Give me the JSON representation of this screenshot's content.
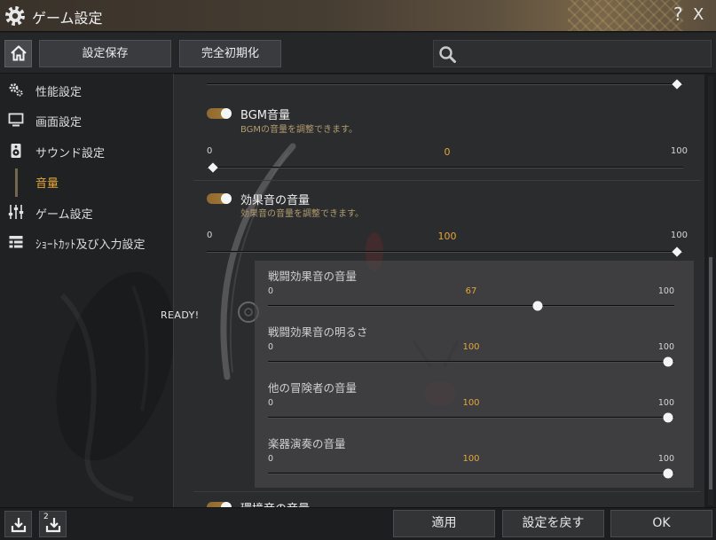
{
  "window": {
    "title": "ゲーム設定",
    "help_label": "?",
    "close_label": "X"
  },
  "toolbar": {
    "home_icon": "home-icon",
    "save_label": "設定保存",
    "reset_all_label": "完全初期化",
    "search": {
      "placeholder": "",
      "value": ""
    },
    "search_icon": "search-icon"
  },
  "sidebar": {
    "items": [
      {
        "label": "性能設定",
        "icon": "gears-icon"
      },
      {
        "label": "画面設定",
        "icon": "monitor-icon"
      },
      {
        "label": "サウンド設定",
        "icon": "speaker-icon"
      },
      {
        "label": "音量",
        "active": true
      },
      {
        "label": "ゲーム設定",
        "icon": "sliders-icon"
      },
      {
        "label": "ｼｮｰﾄｶｯﾄ及び入力設定",
        "icon": "list-icon"
      }
    ]
  },
  "main": {
    "top_slider": {
      "value": 100
    },
    "bgm": {
      "title": "BGM音量",
      "description": "BGMの音量を調整できます。",
      "enabled": true,
      "min": 0,
      "value": 0,
      "max": 100
    },
    "effects": {
      "title": "効果音の音量",
      "description": "効果音の音量を調整できます。",
      "enabled": true,
      "min": 0,
      "value": 100,
      "max": 100
    },
    "sub_sliders": [
      {
        "title": "戦闘効果音の音量",
        "min": 0,
        "value": 67,
        "max": 100
      },
      {
        "title": "戦闘効果音の明るさ",
        "min": 0,
        "value": 100,
        "max": 100
      },
      {
        "title": "他の冒険者の音量",
        "min": 0,
        "value": 100,
        "max": 100
      },
      {
        "title": "楽器演奏の音量",
        "min": 0,
        "value": 100,
        "max": 100
      }
    ],
    "ambient": {
      "title": "環境音の音量",
      "enabled": true
    }
  },
  "footer": {
    "preset_2_badge": "2",
    "apply_label": "適用",
    "revert_label": "設定を戻す",
    "ok_label": "OK"
  },
  "background": {
    "caption": "READY!"
  },
  "colors": {
    "accent": "#e3a63b",
    "toggle": "#a57a35"
  }
}
